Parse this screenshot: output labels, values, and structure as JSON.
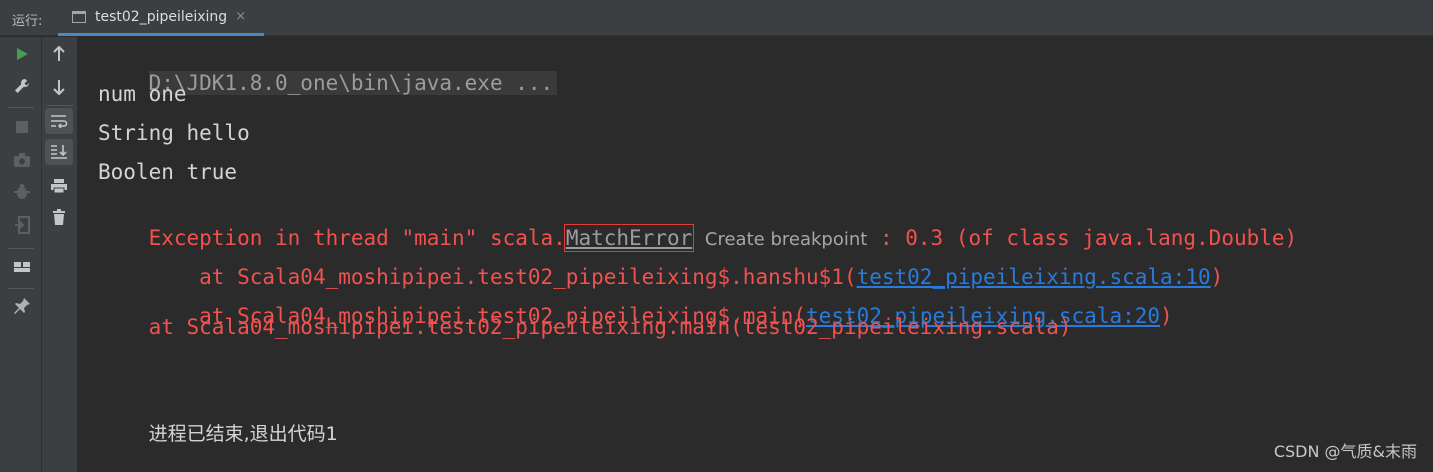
{
  "tabbar": {
    "run_label": "运行:",
    "tab_title": "test02_pipeileixing",
    "tab_close": "×"
  },
  "colors": {
    "background": "#2b2b2b",
    "panel": "#3c3f41",
    "error_text": "#f0524f",
    "link": "#287bde",
    "normal_text": "#d4d4d4",
    "run_green": "#499c54"
  },
  "toolbar_left": [
    "run-icon",
    "wrench-icon",
    "stop-icon",
    "camera-icon",
    "debug-icon",
    "exit-icon",
    "layout-icon",
    "pin-icon"
  ],
  "toolbar_right": [
    "arrow-up-icon",
    "arrow-down-icon",
    "soft-wrap-icon",
    "scroll-to-end-icon",
    "print-icon",
    "trash-icon"
  ],
  "console": {
    "command": "D:\\JDK1.8.0_one\\bin\\java.exe ...",
    "out1": "num one",
    "out2": "String hello",
    "out3": "Boolen true",
    "exception_prefix": "Exception in thread \"main\" scala.",
    "exception_class": "MatchError",
    "breakpoint_hint": "Create breakpoint",
    "exception_suffix": " : 0.3 (of class java.lang.Double)",
    "trace1_prefix": "    at Scala04_moshipipei.test02_pipeileixing$.hanshu$1(",
    "trace1_link": "test02_pipeileixing.scala:10",
    "trace1_suffix": ")",
    "trace2_prefix": "    at Scala04_moshipipei.test02_pipeileixing$.main(",
    "trace2_link": "test02_pipeileixing.scala:20",
    "trace2_suffix": ")",
    "trace3": "    at Scala04_moshipipei.test02_pipeileixing.main(test02_pipeileixing.scala)",
    "exit_message": "进程已结束,退出代码1"
  },
  "watermark": "CSDN @气质&末雨"
}
